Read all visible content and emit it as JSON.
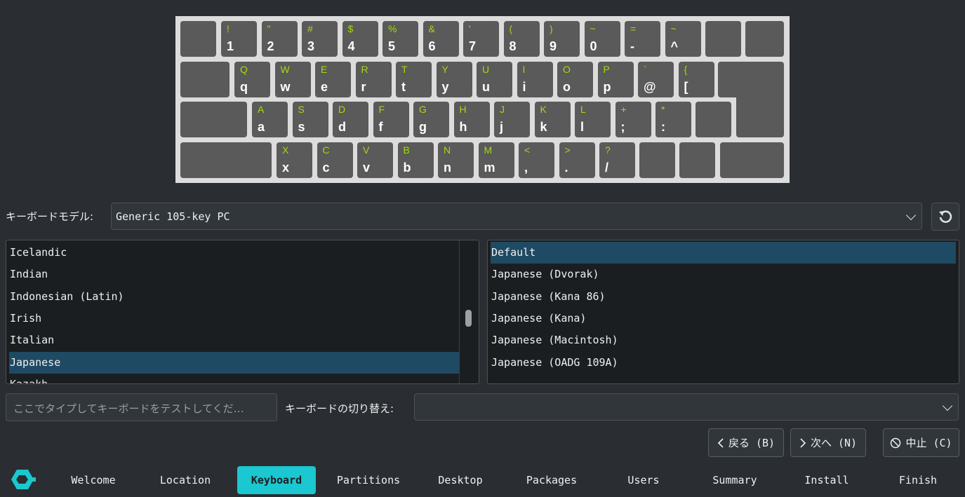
{
  "keyboard_preview": {
    "rows": [
      [
        [
          "!",
          "1"
        ],
        [
          "\"",
          "2"
        ],
        [
          "#",
          "3"
        ],
        [
          "$",
          "4"
        ],
        [
          "%",
          "5"
        ],
        [
          "&",
          "6"
        ],
        [
          "'",
          "7"
        ],
        [
          "(",
          "8"
        ],
        [
          ")",
          "9"
        ],
        [
          "~",
          "0"
        ],
        [
          "=",
          "-"
        ],
        [
          "~",
          "^"
        ]
      ],
      [
        [
          "Q",
          "q"
        ],
        [
          "W",
          "w"
        ],
        [
          "E",
          "e"
        ],
        [
          "R",
          "r"
        ],
        [
          "T",
          "t"
        ],
        [
          "Y",
          "y"
        ],
        [
          "U",
          "u"
        ],
        [
          "I",
          "i"
        ],
        [
          "O",
          "o"
        ],
        [
          "P",
          "p"
        ],
        [
          "`",
          "@"
        ],
        [
          "{",
          "["
        ]
      ],
      [
        [
          "A",
          "a"
        ],
        [
          "S",
          "s"
        ],
        [
          "D",
          "d"
        ],
        [
          "F",
          "f"
        ],
        [
          "G",
          "g"
        ],
        [
          "H",
          "h"
        ],
        [
          "J",
          "j"
        ],
        [
          "K",
          "k"
        ],
        [
          "L",
          "l"
        ],
        [
          "+",
          ";"
        ],
        [
          "*",
          ":"
        ]
      ],
      [
        [
          "X",
          "x"
        ],
        [
          "C",
          "c"
        ],
        [
          "V",
          "v"
        ],
        [
          "B",
          "b"
        ],
        [
          "N",
          "n"
        ],
        [
          "M",
          "m"
        ],
        [
          "<",
          ","
        ],
        [
          ">",
          "."
        ],
        [
          "?",
          "/"
        ]
      ]
    ],
    "upper_color": "#a3d90f"
  },
  "model": {
    "label": "キーボードモデル:",
    "value": "Generic 105-key PC",
    "reset_icon": "undo-icon"
  },
  "layouts": {
    "items": [
      "Icelandic",
      "Indian",
      "Indonesian (Latin)",
      "Irish",
      "Italian",
      "Japanese",
      "Kazakh"
    ],
    "selected": "Japanese"
  },
  "variants": {
    "items": [
      "Default",
      "Japanese (Dvorak)",
      "Japanese (Kana 86)",
      "Japanese (Kana)",
      "Japanese (Macintosh)",
      "Japanese (OADG 109A)"
    ],
    "selected": "Default"
  },
  "test_input": {
    "placeholder": "ここでタイプしてキーボードをテストしてくだ…"
  },
  "switch": {
    "label": "キーボードの切り替え:",
    "value": ""
  },
  "buttons": {
    "back": "戻る (B)",
    "next": "次へ (N)",
    "cancel": "中止 (C)"
  },
  "steps": [
    "Welcome",
    "Location",
    "Keyboard",
    "Partitions",
    "Desktop",
    "Packages",
    "Users",
    "Summary",
    "Install",
    "Finish"
  ],
  "active_step": "Keyboard",
  "accent": "#1bc7d0",
  "selection_color": "#1f4a63"
}
